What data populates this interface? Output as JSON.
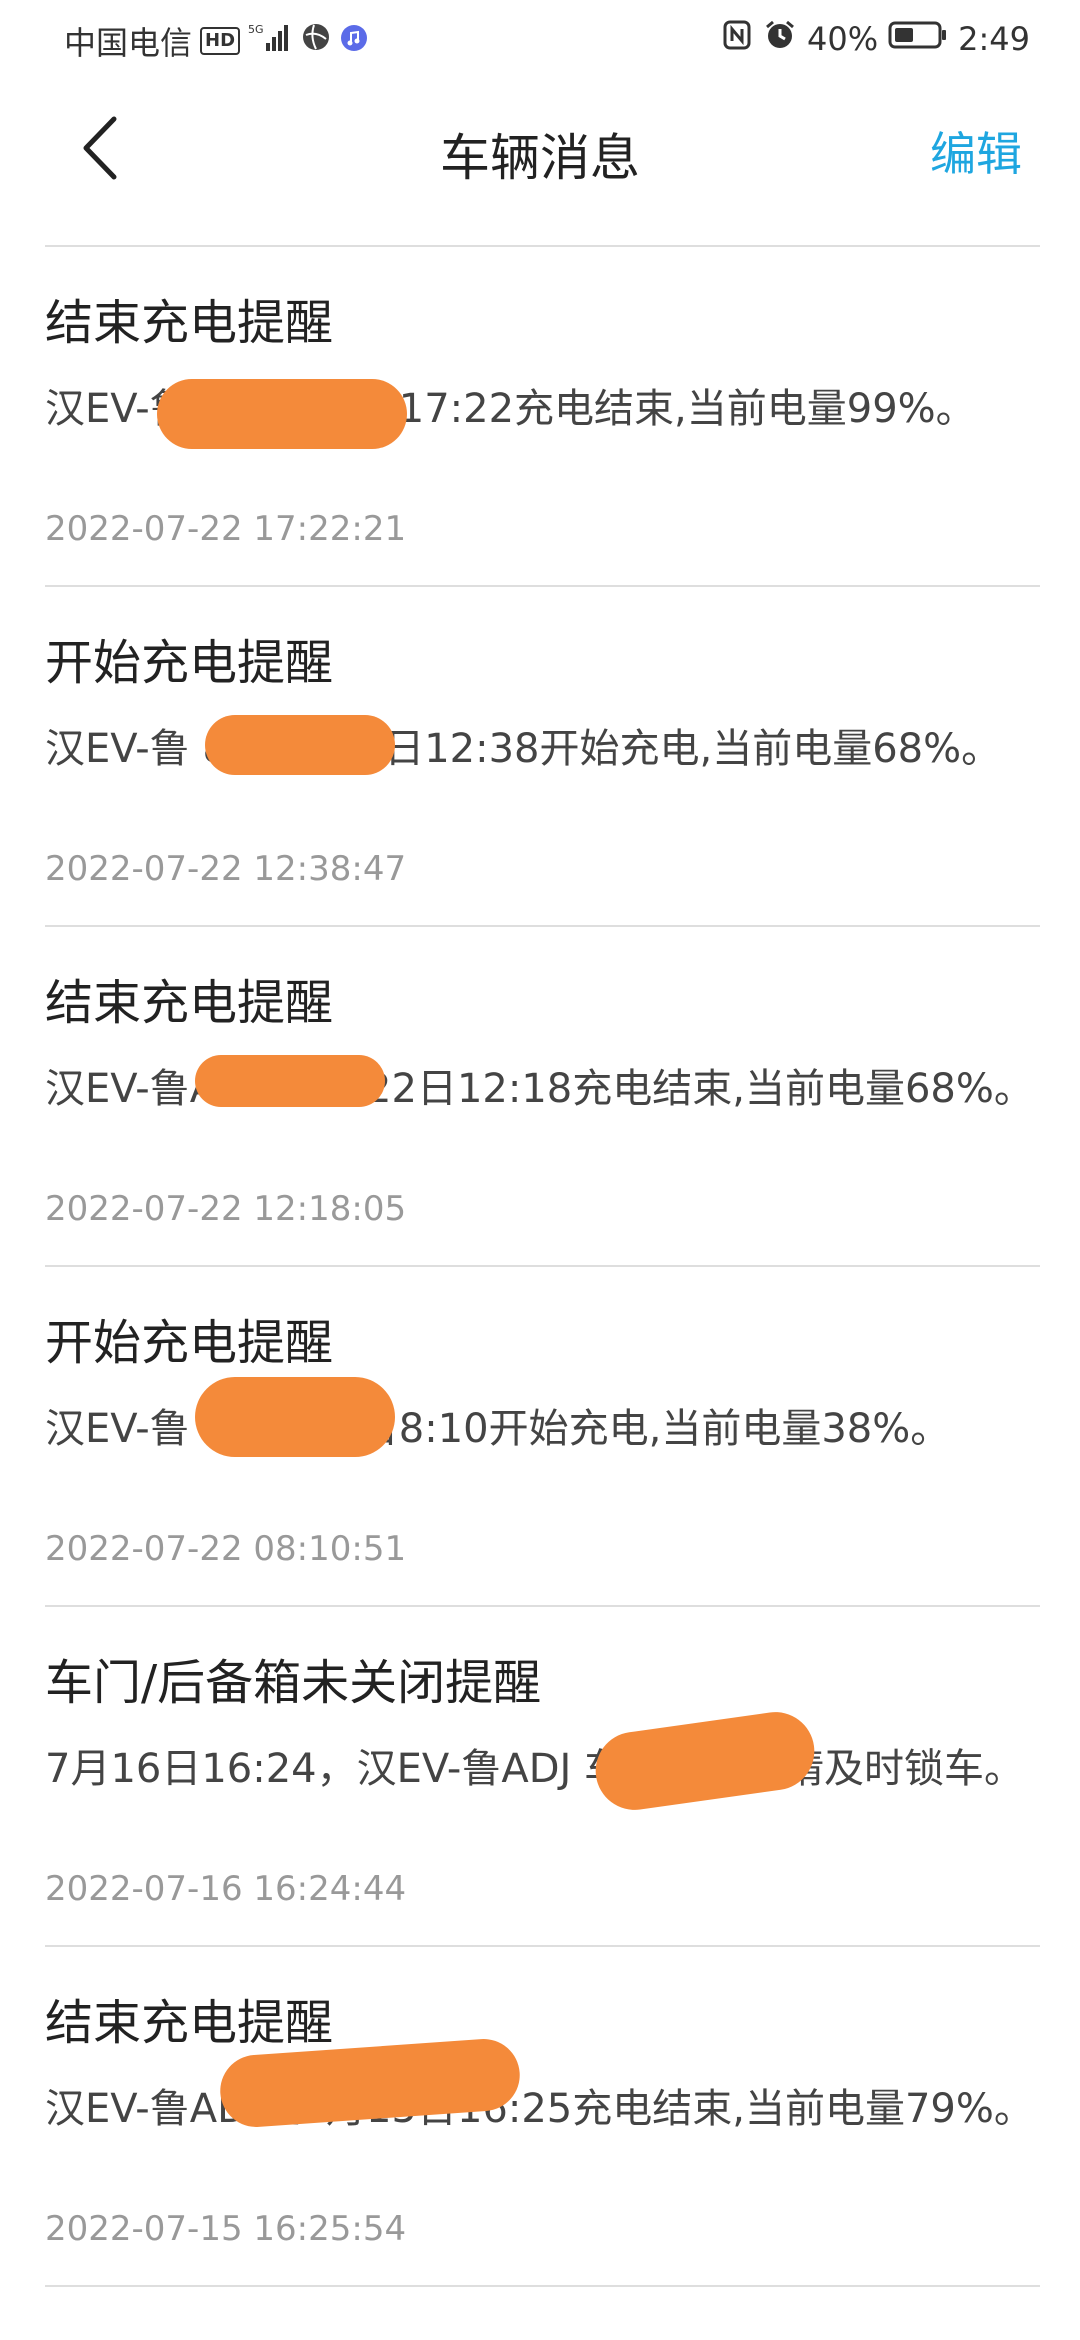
{
  "status_bar": {
    "carrier": "中国电信",
    "hd": "HD",
    "network": "5G",
    "battery_percent": "40%",
    "time": "2:49"
  },
  "nav": {
    "title": "车辆消息",
    "edit_label": "编辑",
    "back_icon": "chevron-left-icon"
  },
  "messages": [
    {
      "title": "结束充电提醒",
      "body": "汉EV-鲁                 在7月22日17:22充电结束,当前电量99%。",
      "time": "2022-07-22 17:22:21"
    },
    {
      "title": "开始充电提醒",
      "body": "汉EV-鲁                 8在7月22日12:38开始充电,当前电量68%。",
      "time": "2022-07-22 12:38:47"
    },
    {
      "title": "结束充电提醒",
      "body": "汉EV-鲁AD               在7月22日12:18充电结束,当前电量68%。",
      "time": "2022-07-22 12:18:05"
    },
    {
      "title": "开始充电提醒",
      "body": "汉EV-鲁                 在7月22日8:10开始充电,当前电量38%。",
      "time": "2022-07-22 08:10:51"
    },
    {
      "title": "车门/后备箱未关闭提醒",
      "body": "7月16日16:24，汉EV-鲁ADJ                 车门未锁，请及时锁车。",
      "time": "2022-07-16 16:24:44"
    },
    {
      "title": "结束充电提醒",
      "body": "汉EV-鲁AD                 在7月15日16:25充电结束,当前电量79%。",
      "time": "2022-07-15 16:25:54"
    }
  ]
}
